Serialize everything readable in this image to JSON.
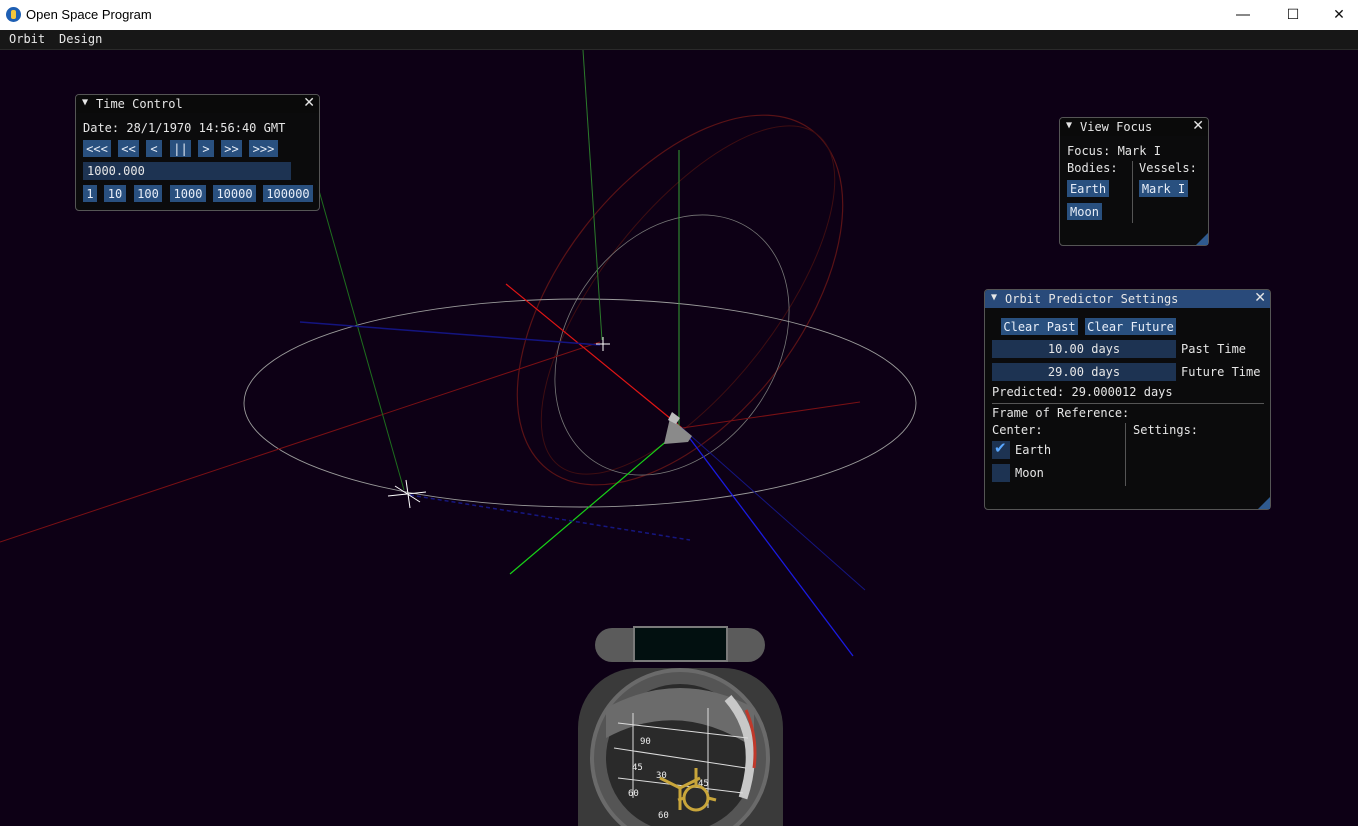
{
  "window": {
    "title": "Open Space Program",
    "minimize_icon": "minimize-icon",
    "maximize_icon": "maximize-icon",
    "close_icon": "close-icon"
  },
  "menu": {
    "items": [
      "Orbit",
      "Design"
    ]
  },
  "time_control": {
    "title": "Time Control",
    "date": "Date: 28/1/1970 14:56:40 GMT",
    "controls": [
      "<<<",
      "<<",
      "<",
      "||",
      ">",
      ">>",
      ">>>"
    ],
    "warp_value": "1000.000",
    "presets": [
      "1",
      "10",
      "100",
      "1000",
      "10000",
      "100000"
    ]
  },
  "view_focus": {
    "title": "View Focus",
    "focus": "Focus: Mark I",
    "bodies_label": "Bodies:",
    "vessels_label": "Vessels:",
    "bodies": [
      "Earth",
      "Moon"
    ],
    "vessels": [
      "Mark I"
    ]
  },
  "orbit_predictor": {
    "title": "Orbit Predictor Settings",
    "clear_past": "Clear Past",
    "clear_future": "Clear Future",
    "past_value": "10.00 days",
    "past_label": "Past Time",
    "future_value": "29.00 days",
    "future_label": "Future Time",
    "predicted": "Predicted: 29.000012 days",
    "frame_label": "Frame of Reference:",
    "center_label": "Center:",
    "settings_label": "Settings:",
    "centers": [
      {
        "name": "Earth",
        "checked": true
      },
      {
        "name": "Moon",
        "checked": false
      }
    ]
  },
  "navball": {
    "readout": "",
    "scale_labels": [
      "90",
      "45",
      "30",
      "60",
      "45",
      "60",
      "30"
    ]
  },
  "colors": {
    "background": "#0d0015",
    "accent": "#29507f",
    "title_active": "#294a7a"
  }
}
